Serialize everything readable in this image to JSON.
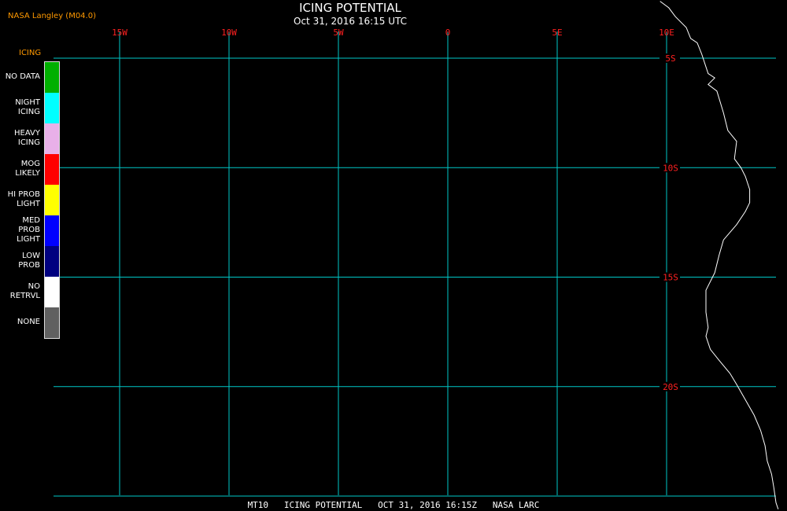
{
  "header": {
    "source": "NASA Langley (M04.0)",
    "title": "ICING POTENTIAL",
    "subtitle": "Oct 31, 2016 16:15 UTC"
  },
  "legend": {
    "title": "ICING",
    "items": [
      {
        "label": "NO DATA",
        "color": "#00b000"
      },
      {
        "label": "NIGHT\nICING",
        "color": "#00ffff"
      },
      {
        "label": "HEAVY\nICING",
        "color": "#e8b0e8"
      },
      {
        "label": "MOG\nLIKELY",
        "color": "#ff0000"
      },
      {
        "label": "HI PROB\nLIGHT",
        "color": "#ffff00"
      },
      {
        "label": "MED PROB\nLIGHT",
        "color": "#0000ff"
      },
      {
        "label": "LOW\nPROB",
        "color": "#000080"
      },
      {
        "label": "NO\nRETRVL",
        "color": "#ffffff"
      },
      {
        "label": "NONE",
        "color": "#606060"
      }
    ]
  },
  "map": {
    "grid_color": "#00c8c8",
    "label_color": "#ff2020",
    "coast_color": "#ffffff",
    "longitudes": [
      {
        "lon": -15,
        "label": "15W"
      },
      {
        "lon": -10,
        "label": "10W"
      },
      {
        "lon": -5,
        "label": "5W"
      },
      {
        "lon": 0,
        "label": "0"
      },
      {
        "lon": 5,
        "label": "5E"
      },
      {
        "lon": 10,
        "label": "10E"
      }
    ],
    "latitudes": [
      {
        "lat": -5,
        "label": "5S"
      },
      {
        "lat": -10,
        "label": "10S"
      },
      {
        "lat": -15,
        "label": "15S"
      },
      {
        "lat": -20,
        "label": "20S"
      },
      {
        "lat": -25,
        "label": ""
      }
    ],
    "coastline": [
      [
        9.7,
        -2.4
      ],
      [
        10.1,
        -2.7
      ],
      [
        10.4,
        -3.1
      ],
      [
        10.9,
        -3.6
      ],
      [
        11.1,
        -4.1
      ],
      [
        11.4,
        -4.3
      ],
      [
        11.6,
        -4.8
      ],
      [
        11.9,
        -5.7
      ],
      [
        12.2,
        -5.9
      ],
      [
        11.9,
        -6.2
      ],
      [
        12.3,
        -6.5
      ],
      [
        12.6,
        -7.5
      ],
      [
        12.8,
        -8.3
      ],
      [
        13.2,
        -8.8
      ],
      [
        13.1,
        -9.6
      ],
      [
        13.4,
        -10.0
      ],
      [
        13.6,
        -10.4
      ],
      [
        13.8,
        -11.0
      ],
      [
        13.8,
        -11.6
      ],
      [
        13.6,
        -12.0
      ],
      [
        13.2,
        -12.6
      ],
      [
        12.6,
        -13.3
      ],
      [
        12.4,
        -14.0
      ],
      [
        12.2,
        -14.8
      ],
      [
        11.8,
        -15.6
      ],
      [
        11.8,
        -16.6
      ],
      [
        11.9,
        -17.3
      ],
      [
        11.8,
        -17.7
      ],
      [
        12.0,
        -18.3
      ],
      [
        12.4,
        -18.8
      ],
      [
        12.9,
        -19.4
      ],
      [
        13.2,
        -19.9
      ],
      [
        13.6,
        -20.6
      ],
      [
        14.0,
        -21.3
      ],
      [
        14.3,
        -22.0
      ],
      [
        14.5,
        -22.7
      ],
      [
        14.6,
        -23.4
      ],
      [
        14.8,
        -24.0
      ],
      [
        14.9,
        -24.6
      ],
      [
        15.0,
        -25.3
      ],
      [
        15.1,
        -25.6
      ]
    ]
  },
  "footer": {
    "text": "MT10   ICING POTENTIAL   OCT 31, 2016 16:15Z   NASA LARC"
  }
}
